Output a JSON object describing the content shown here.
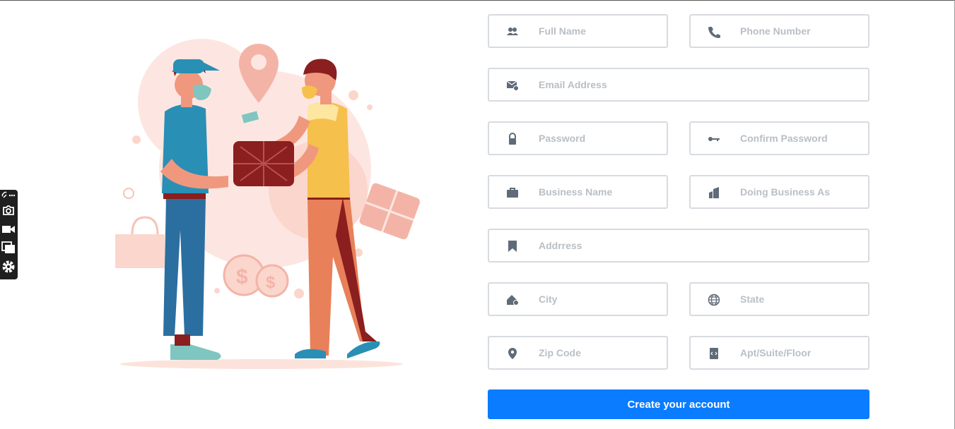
{
  "form": {
    "fields": [
      {
        "id": "full-name",
        "placeholder": "Full Name",
        "icon": "users-icon",
        "value": ""
      },
      {
        "id": "phone",
        "placeholder": "Phone Number",
        "icon": "phone-icon",
        "value": ""
      },
      {
        "id": "email",
        "placeholder": "Email Address",
        "icon": "envelope-icon",
        "value": ""
      },
      {
        "id": "password",
        "placeholder": "Password",
        "icon": "lock-icon",
        "value": ""
      },
      {
        "id": "confirm-password",
        "placeholder": "Confirm Password",
        "icon": "key-icon",
        "value": ""
      },
      {
        "id": "business-name",
        "placeholder": "Business Name",
        "icon": "briefcase-icon",
        "value": ""
      },
      {
        "id": "dba",
        "placeholder": "Doing Business As",
        "icon": "building-icon",
        "value": ""
      },
      {
        "id": "address",
        "placeholder": "Addrress",
        "icon": "bookmark-icon",
        "value": ""
      },
      {
        "id": "city",
        "placeholder": "City",
        "icon": "city-icon",
        "value": ""
      },
      {
        "id": "state",
        "placeholder": "State",
        "icon": "globe-icon",
        "value": ""
      },
      {
        "id": "zip",
        "placeholder": "Zip Code",
        "icon": "map-marker-icon",
        "value": ""
      },
      {
        "id": "apt",
        "placeholder": "Apt/Suite/Floor",
        "icon": "door-icon",
        "value": ""
      }
    ],
    "submit_label": "Create your account"
  },
  "toolbar": {
    "items": [
      "link-icon",
      "camera-icon",
      "video-icon",
      "copy-icon",
      "settings-icon"
    ]
  },
  "colors": {
    "accent": "#0a7cff",
    "field_border": "#d7dbe0",
    "placeholder": "#b9bfc6",
    "icon": "#5f6b78"
  }
}
